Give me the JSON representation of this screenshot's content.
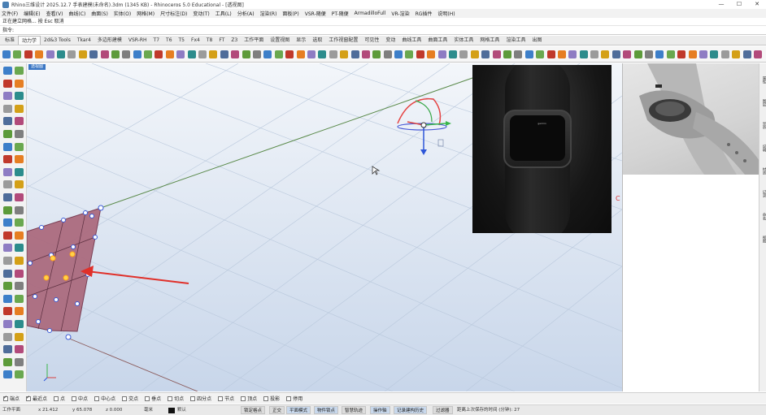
{
  "window": {
    "title": "Rhino三维设计 2025.12.7 手表建模(未命名).3dm (1345 KB) - Rhinoceros 5.0 Educational - [透视图]",
    "controls": [
      "—",
      "☐",
      "✕"
    ]
  },
  "menu": {
    "items": [
      "文件(F)",
      "编辑(E)",
      "查看(V)",
      "曲线(C)",
      "曲面(S)",
      "实体(O)",
      "网格(M)",
      "尺寸标注(D)",
      "变动(T)",
      "工具(L)",
      "分析(A)",
      "渲染(R)",
      "面板(P)",
      "VSR-随便",
      "PT-随便",
      "ArmadilloFull",
      "VR-渲染",
      "RG插件",
      "说明(H)"
    ]
  },
  "command": {
    "history": "正在建立网格... 按 Esc 取消",
    "prompt": "指令:"
  },
  "toolbar_tabs": {
    "items": [
      "标准",
      "动力学",
      "2d&3 Tools",
      "Tkar4",
      "多边形建模",
      "VSR-RH",
      "T7",
      "T6",
      "T5",
      "Fx4",
      "T8",
      "FT",
      "Z3",
      "工作平面",
      "设置视图",
      "显示",
      "选取",
      "工作视窗配置",
      "可见性",
      "变动",
      "曲线工具",
      "曲面工具",
      "实体工具",
      "网格工具",
      "渲染工具",
      "出图"
    ],
    "active_index": 1
  },
  "viewport": {
    "label": "透视图",
    "marker": "C"
  },
  "reference_photo": {
    "brand": "garmin"
  },
  "side_tabs": [
    "属性",
    "图层",
    "显示",
    "说明",
    "材质",
    "记录",
    "命名",
    "视图"
  ],
  "osnap": {
    "items": [
      {
        "label": "端点",
        "checked": true
      },
      {
        "label": "最近点",
        "checked": true
      },
      {
        "label": "点",
        "checked": false
      },
      {
        "label": "中点",
        "checked": false
      },
      {
        "label": "中心点",
        "checked": false
      },
      {
        "label": "交点",
        "checked": false
      },
      {
        "label": "垂点",
        "checked": false
      },
      {
        "label": "切点",
        "checked": false
      },
      {
        "label": "四分点",
        "checked": false
      },
      {
        "label": "节点",
        "checked": false
      },
      {
        "label": "顶点",
        "checked": false
      },
      {
        "label": "投影",
        "checked": false
      },
      {
        "label": "停用",
        "checked": false
      }
    ]
  },
  "status": {
    "cplane": "工作平面",
    "x": "x 21.412",
    "y": "y 65.078",
    "z": "z 0.000",
    "units": "毫米",
    "layer": "默认",
    "buttons": [
      {
        "label": "锁定格点",
        "on": false
      },
      {
        "label": "正交",
        "on": false
      },
      {
        "label": "平面模式",
        "on": true
      },
      {
        "label": "物件锁点",
        "on": true
      },
      {
        "label": "智慧轨迹",
        "on": false
      },
      {
        "label": "操作轴",
        "on": true
      },
      {
        "label": "记录建构历史",
        "on": true
      },
      {
        "label": "过滤器",
        "on": false
      }
    ],
    "message": "距离上次保存的时间 (分钟): 27"
  }
}
